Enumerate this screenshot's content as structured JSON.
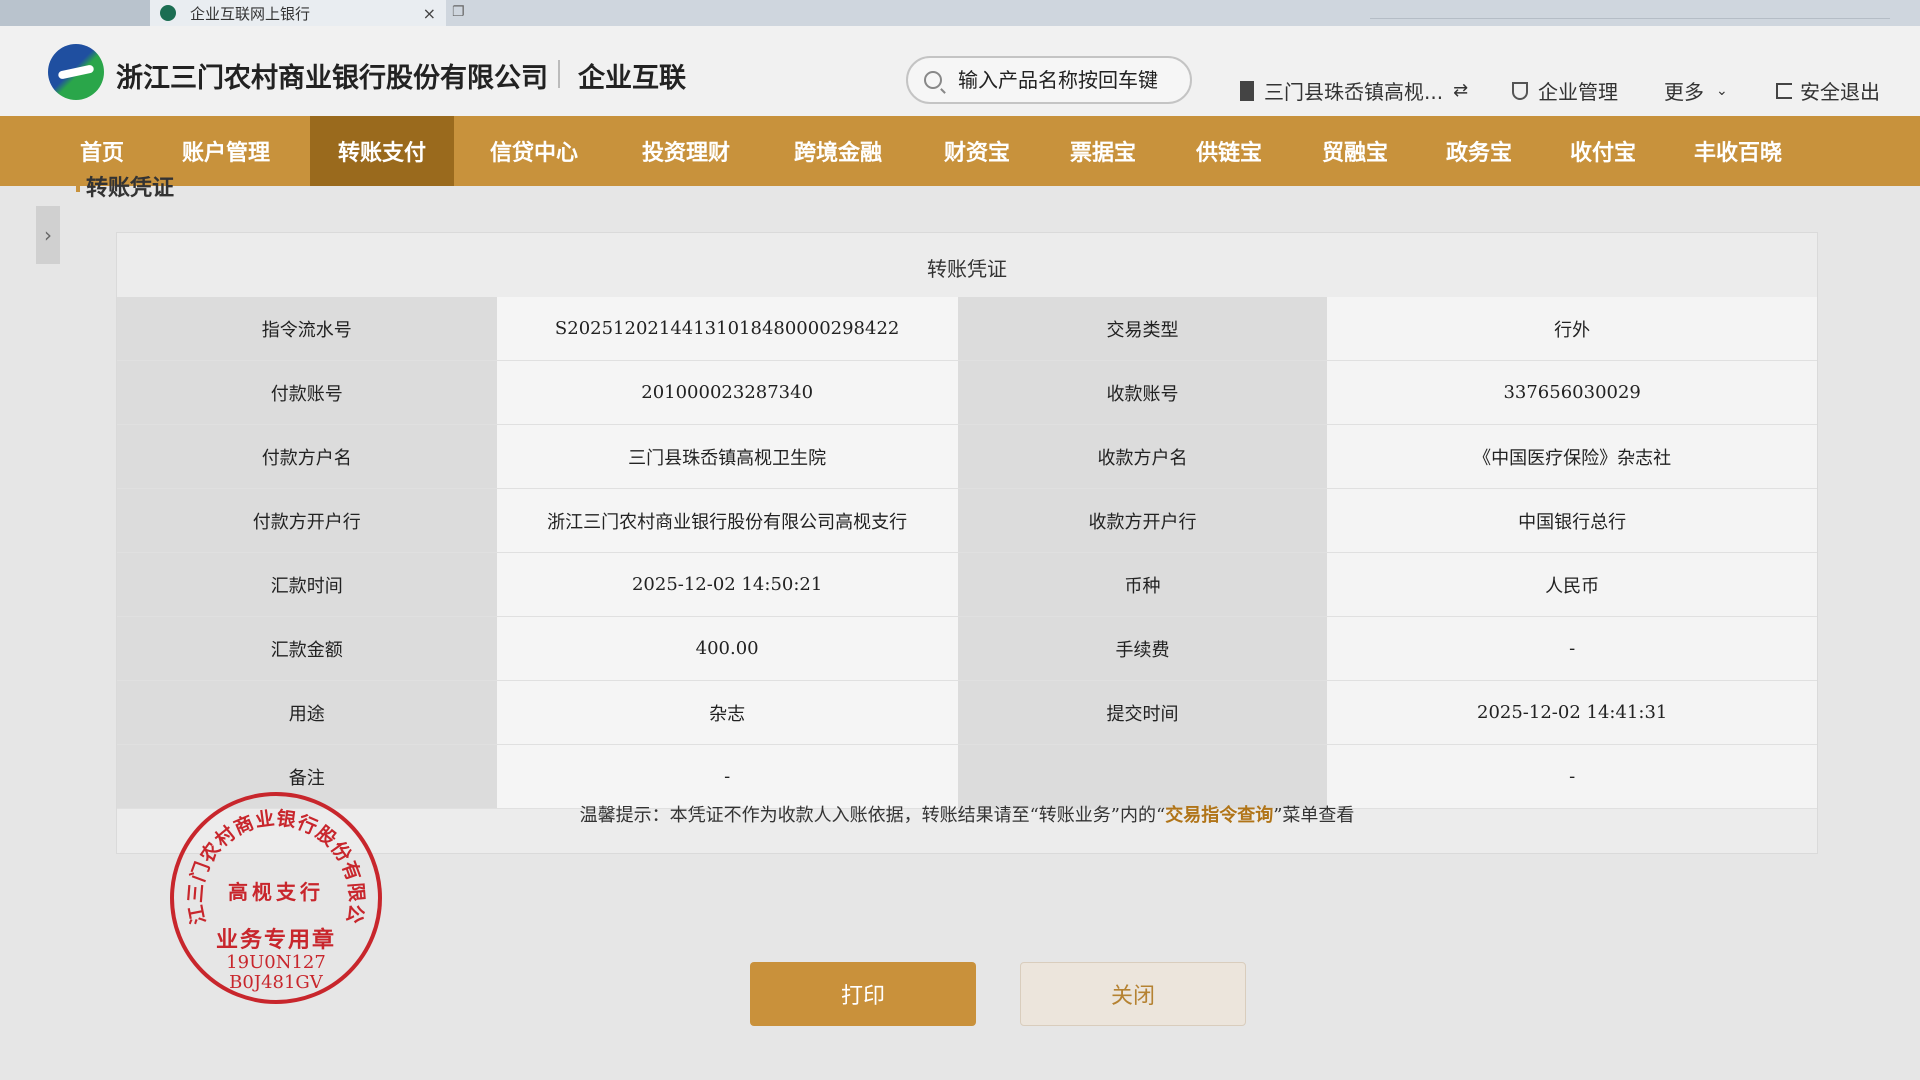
{
  "browser": {
    "tab_title": "企业互联网上银行",
    "tab_close": "×",
    "new_tab": "❐"
  },
  "header": {
    "bank_name": "浙江三门农村商业银行股份有限公司",
    "product": "企业互联",
    "search_placeholder": "输入产品名称按回车键",
    "org_name": "三门县珠岙镇高枧...",
    "switch_icon": "⇄",
    "enterprise_mgmt": "企业管理",
    "more": "更多",
    "more_icon": "⌄",
    "logout": "安全退出"
  },
  "nav": {
    "items": [
      "首页",
      "账户管理",
      "转账支付",
      "信贷中心",
      "投资理财",
      "跨境金融",
      "财资宝",
      "票据宝",
      "供链宝",
      "贸融宝",
      "政务宝",
      "收付宝",
      "丰收百晓"
    ],
    "active_index": 2
  },
  "page": {
    "title": "转账凭证",
    "side_toggle": "›"
  },
  "voucher": {
    "title": "转账凭证",
    "rows": [
      {
        "l1": "指令流水号",
        "v1": "S20251202144131018480000298422",
        "l2": "交易类型",
        "v2": "行外"
      },
      {
        "l1": "付款账号",
        "v1": "201000023287340",
        "l2": "收款账号",
        "v2": "337656030029"
      },
      {
        "l1": "付款方户名",
        "v1": "三门县珠岙镇高枧卫生院",
        "l2": "收款方户名",
        "v2": "《中国医疗保险》杂志社"
      },
      {
        "l1": "付款方开户行",
        "v1": "浙江三门农村商业银行股份有限公司高枧支行",
        "l2": "收款方开户行",
        "v2": "中国银行总行"
      },
      {
        "l1": "汇款时间",
        "v1": "2025-12-02 14:50:21",
        "l2": "币种",
        "v2": "人民币"
      },
      {
        "l1": "汇款金额",
        "v1": "400.00",
        "l2": "手续费",
        "v2": "-"
      },
      {
        "l1": "用途",
        "v1": "杂志",
        "l2": "提交时间",
        "v2": "2025-12-02 14:41:31"
      },
      {
        "l1": "备注",
        "v1": "-",
        "l2": "",
        "v2": "-"
      }
    ],
    "tip_prefix": "温馨提示：本凭证不作为收款人入账依据，转账结果请至“转账业务”内的“",
    "tip_link": "交易指令查询",
    "tip_suffix": "”菜单查看"
  },
  "stamp": {
    "ring_text": "浙江三门农村商业银行股份有限公司",
    "branch": "高枧支行",
    "usage": "业务专用章",
    "code1": "19U0N127",
    "code2": "B0J481GV",
    "color": "#c8262c"
  },
  "buttons": {
    "print": "打印",
    "close": "关闭"
  },
  "colors": {
    "accent": "#c8923c",
    "nav_active": "#9a6a1d",
    "link": "#b07418"
  }
}
